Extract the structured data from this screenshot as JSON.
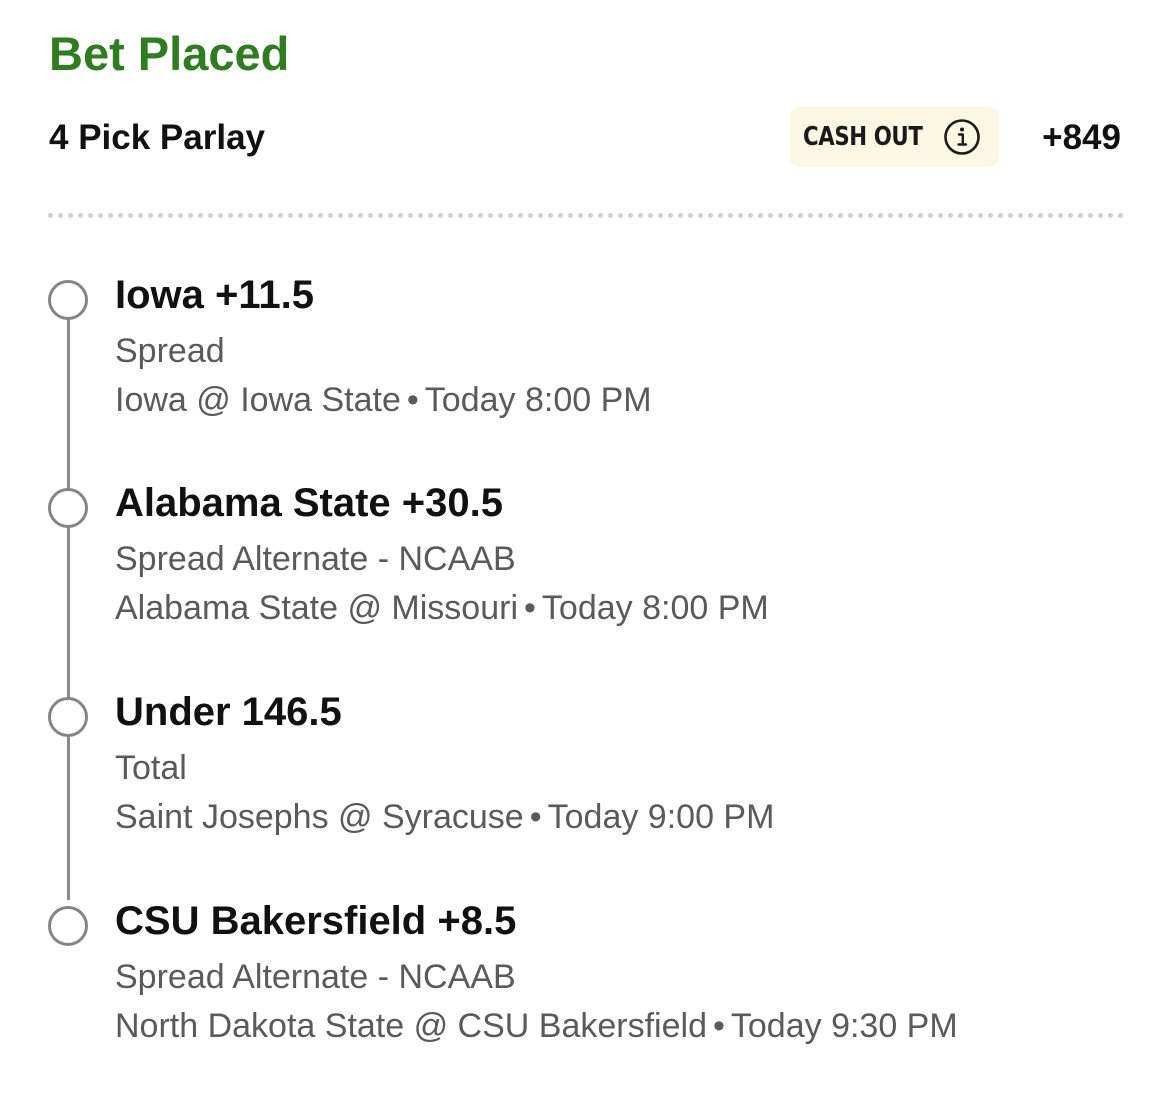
{
  "header": {
    "status": "Bet Placed",
    "bet_type": "4 Pick Parlay",
    "cash_out_label": "CASH OUT",
    "cash_out_info_icon": "info-circle-icon",
    "odds": "+849"
  },
  "colors": {
    "status_green": "#2e7d1e",
    "cash_out_bg": "#fbf7e3",
    "secondary_text": "#5a5a5a",
    "timeline_gray": "#858585"
  },
  "legs": [
    {
      "selection": "Iowa +11.5",
      "market": "Spread",
      "event": "Iowa @ Iowa State",
      "separator": "•",
      "time": "Today 8:00 PM"
    },
    {
      "selection": "Alabama State +30.5",
      "market": "Spread Alternate - NCAAB",
      "event": "Alabama State @ Missouri",
      "separator": "•",
      "time": "Today 8:00 PM"
    },
    {
      "selection": "Under 146.5",
      "market": "Total",
      "event": "Saint Josephs @ Syracuse",
      "separator": "•",
      "time": "Today 9:00 PM"
    },
    {
      "selection": "CSU Bakersfield +8.5",
      "market": "Spread Alternate - NCAAB",
      "event": "North Dakota State @ CSU Bakersfield",
      "separator": "•",
      "time": "Today 9:30 PM"
    }
  ]
}
